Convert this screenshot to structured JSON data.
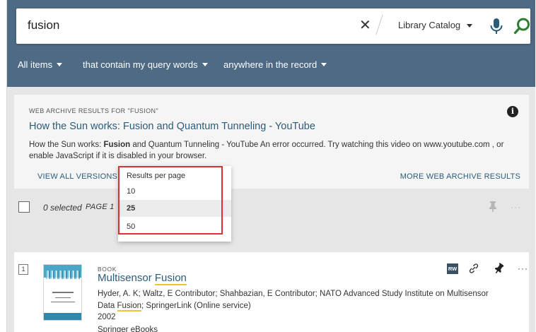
{
  "search": {
    "query": "fusion",
    "clear_symbol": "✕",
    "scope": "Library Catalog"
  },
  "filters": {
    "items": "All items",
    "match": "that contain my query words",
    "location": "anywhere in the record"
  },
  "web_archive": {
    "label": "WEB ARCHIVE RESULTS FOR \"FUSION\"",
    "info": "i",
    "title": "How the Sun works: Fusion and Quantum Tunneling - YouTube",
    "snippet_before": "How the Sun works: ",
    "snippet_bold": "Fusion",
    "snippet_after": " and Quantum Tunneling - YouTube An error occurred. Try watching this video on www.youtube.com , or enable JavaScript if it is disabled in your browser.",
    "view_all": "VIEW ALL VERSIONS",
    "more": "MORE WEB ARCHIVE RESULTS"
  },
  "toolbar": {
    "selected": "0 selected",
    "page": "PAGE 1",
    "more_symbol": "···"
  },
  "per_page_menu": {
    "title": "Results per page",
    "options": [
      "10",
      "25",
      "50"
    ],
    "selected": "25"
  },
  "result": {
    "number": "1",
    "type": "BOOK",
    "title_plain": "Multisensor ",
    "title_highlight": "Fusion",
    "authors_before": "Hyder, A. K; Waltz, E Contributor; Shahbazian, E Contributor; NATO Advanced Study Institute on Multisensor Data ",
    "authors_highlight": "Fusion",
    "authors_after": "; SpringerLink (Online service)",
    "year": "2002",
    "source": "Springer eBooks",
    "badge": "RW",
    "more_symbol": "···"
  },
  "colors": {
    "header": "#4e6a84",
    "link": "#2a5c7a",
    "search_accent": "#2e7d32",
    "mic": "#2a5c7a",
    "highlight_border": "#e03030",
    "term_highlight": "#f1c232"
  }
}
